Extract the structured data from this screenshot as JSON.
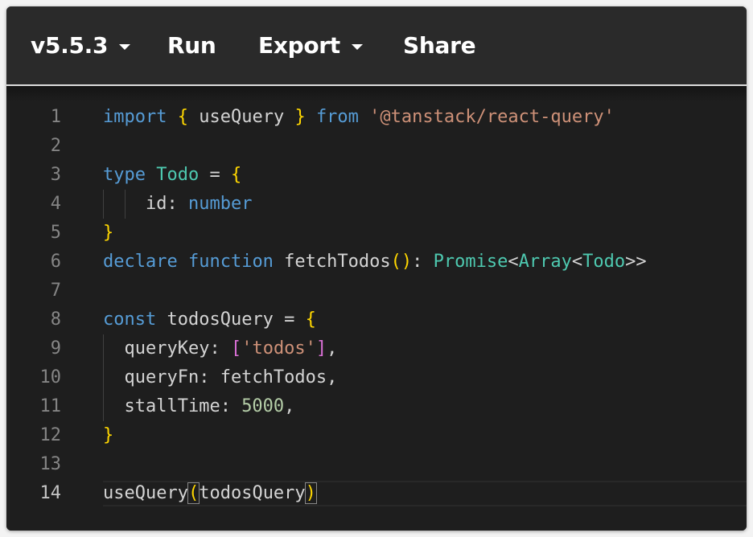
{
  "toolbar": {
    "version_label": "v5.5.3",
    "run_label": "Run",
    "export_label": "Export",
    "share_label": "Share"
  },
  "editor": {
    "active_line": 14,
    "lines": [
      {
        "n": "1",
        "tokens": [
          {
            "t": "import",
            "c": "kw"
          },
          {
            "t": " "
          },
          {
            "t": "{",
            "c": "b1"
          },
          {
            "t": " useQuery "
          },
          {
            "t": "}",
            "c": "b1"
          },
          {
            "t": " "
          },
          {
            "t": "from",
            "c": "kw"
          },
          {
            "t": " "
          },
          {
            "t": "'@tanstack/react-query'",
            "c": "st"
          }
        ]
      },
      {
        "n": "2",
        "tokens": []
      },
      {
        "n": "3",
        "tokens": [
          {
            "t": "type",
            "c": "kw"
          },
          {
            "t": " "
          },
          {
            "t": "Todo",
            "c": "ty"
          },
          {
            "t": " = "
          },
          {
            "t": "{",
            "c": "b1"
          }
        ]
      },
      {
        "n": "4",
        "tokens": [
          {
            "t": "    id: "
          },
          {
            "t": "number",
            "c": "kw"
          }
        ]
      },
      {
        "n": "5",
        "tokens": [
          {
            "t": "}",
            "c": "b1"
          }
        ]
      },
      {
        "n": "6",
        "tokens": [
          {
            "t": "declare",
            "c": "kw"
          },
          {
            "t": " "
          },
          {
            "t": "function",
            "c": "kw"
          },
          {
            "t": " fetchTodos"
          },
          {
            "t": "()",
            "c": "b1"
          },
          {
            "t": ": "
          },
          {
            "t": "Promise",
            "c": "ty"
          },
          {
            "t": "<"
          },
          {
            "t": "Array",
            "c": "ty"
          },
          {
            "t": "<"
          },
          {
            "t": "Todo",
            "c": "ty"
          },
          {
            "t": ">>"
          }
        ]
      },
      {
        "n": "7",
        "tokens": []
      },
      {
        "n": "8",
        "tokens": [
          {
            "t": "const",
            "c": "kw"
          },
          {
            "t": " todosQuery = "
          },
          {
            "t": "{",
            "c": "b1"
          }
        ]
      },
      {
        "n": "9",
        "tokens": [
          {
            "t": "  queryKey: "
          },
          {
            "t": "[",
            "c": "b2"
          },
          {
            "t": "'todos'",
            "c": "st"
          },
          {
            "t": "]",
            "c": "b2"
          },
          {
            "t": ","
          }
        ]
      },
      {
        "n": "10",
        "tokens": [
          {
            "t": "  queryFn: fetchTodos,"
          }
        ]
      },
      {
        "n": "11",
        "tokens": [
          {
            "t": "  stallTime: "
          },
          {
            "t": "5000",
            "c": "nu"
          },
          {
            "t": ","
          }
        ]
      },
      {
        "n": "12",
        "tokens": [
          {
            "t": "}",
            "c": "b1"
          }
        ]
      },
      {
        "n": "13",
        "tokens": []
      },
      {
        "n": "14",
        "tokens": [
          {
            "t": "useQuery"
          },
          {
            "t": "(",
            "c": "b1 bm"
          },
          {
            "t": "todosQuery"
          },
          {
            "t": ")",
            "c": "b1 bm"
          }
        ]
      }
    ]
  },
  "colors": {
    "background": "#1e1e1e",
    "toolbar": "#2a2a2a",
    "keyword": "#569cd6",
    "type": "#4ec9b0",
    "string": "#ce9178",
    "number": "#b5cea8",
    "bracket_level1": "#ffd700",
    "bracket_level2": "#da70d6"
  }
}
